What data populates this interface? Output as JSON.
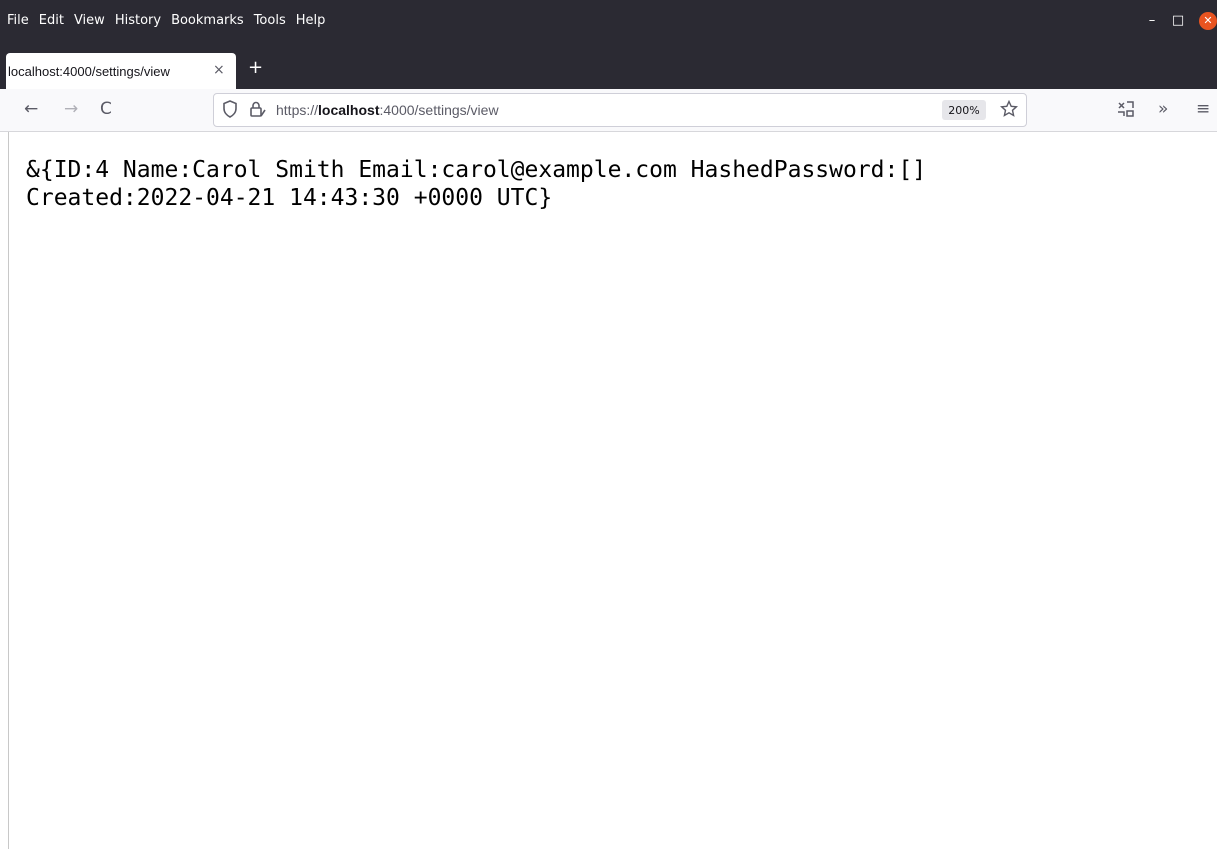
{
  "menu": {
    "file": "File",
    "edit": "Edit",
    "view": "View",
    "history": "History",
    "bookmarks": "Bookmarks",
    "tools": "Tools",
    "help": "Help"
  },
  "window_controls": {
    "minimize": "–",
    "maximize": "□",
    "close": "✕"
  },
  "tab": {
    "title": "localhost:4000/settings/view",
    "close": "×",
    "new_tab": "+"
  },
  "nav": {
    "back": "←",
    "forward": "→",
    "reload": "C",
    "url_prefix": "https://",
    "url_host": "localhost",
    "url_rest": ":4000/settings/view",
    "zoom": "200%",
    "overflow": "»",
    "menu": "≡"
  },
  "icons": {
    "shield": "shield-icon",
    "lock": "lock-icon",
    "bookmark": "star-icon",
    "extension": "extension-icon"
  },
  "content": {
    "line1": "&{ID:4 Name:Carol Smith Email:carol@example.com HashedPassword:[]",
    "line2": "Created:2022-04-21 14:43:30 +0000 UTC}"
  }
}
